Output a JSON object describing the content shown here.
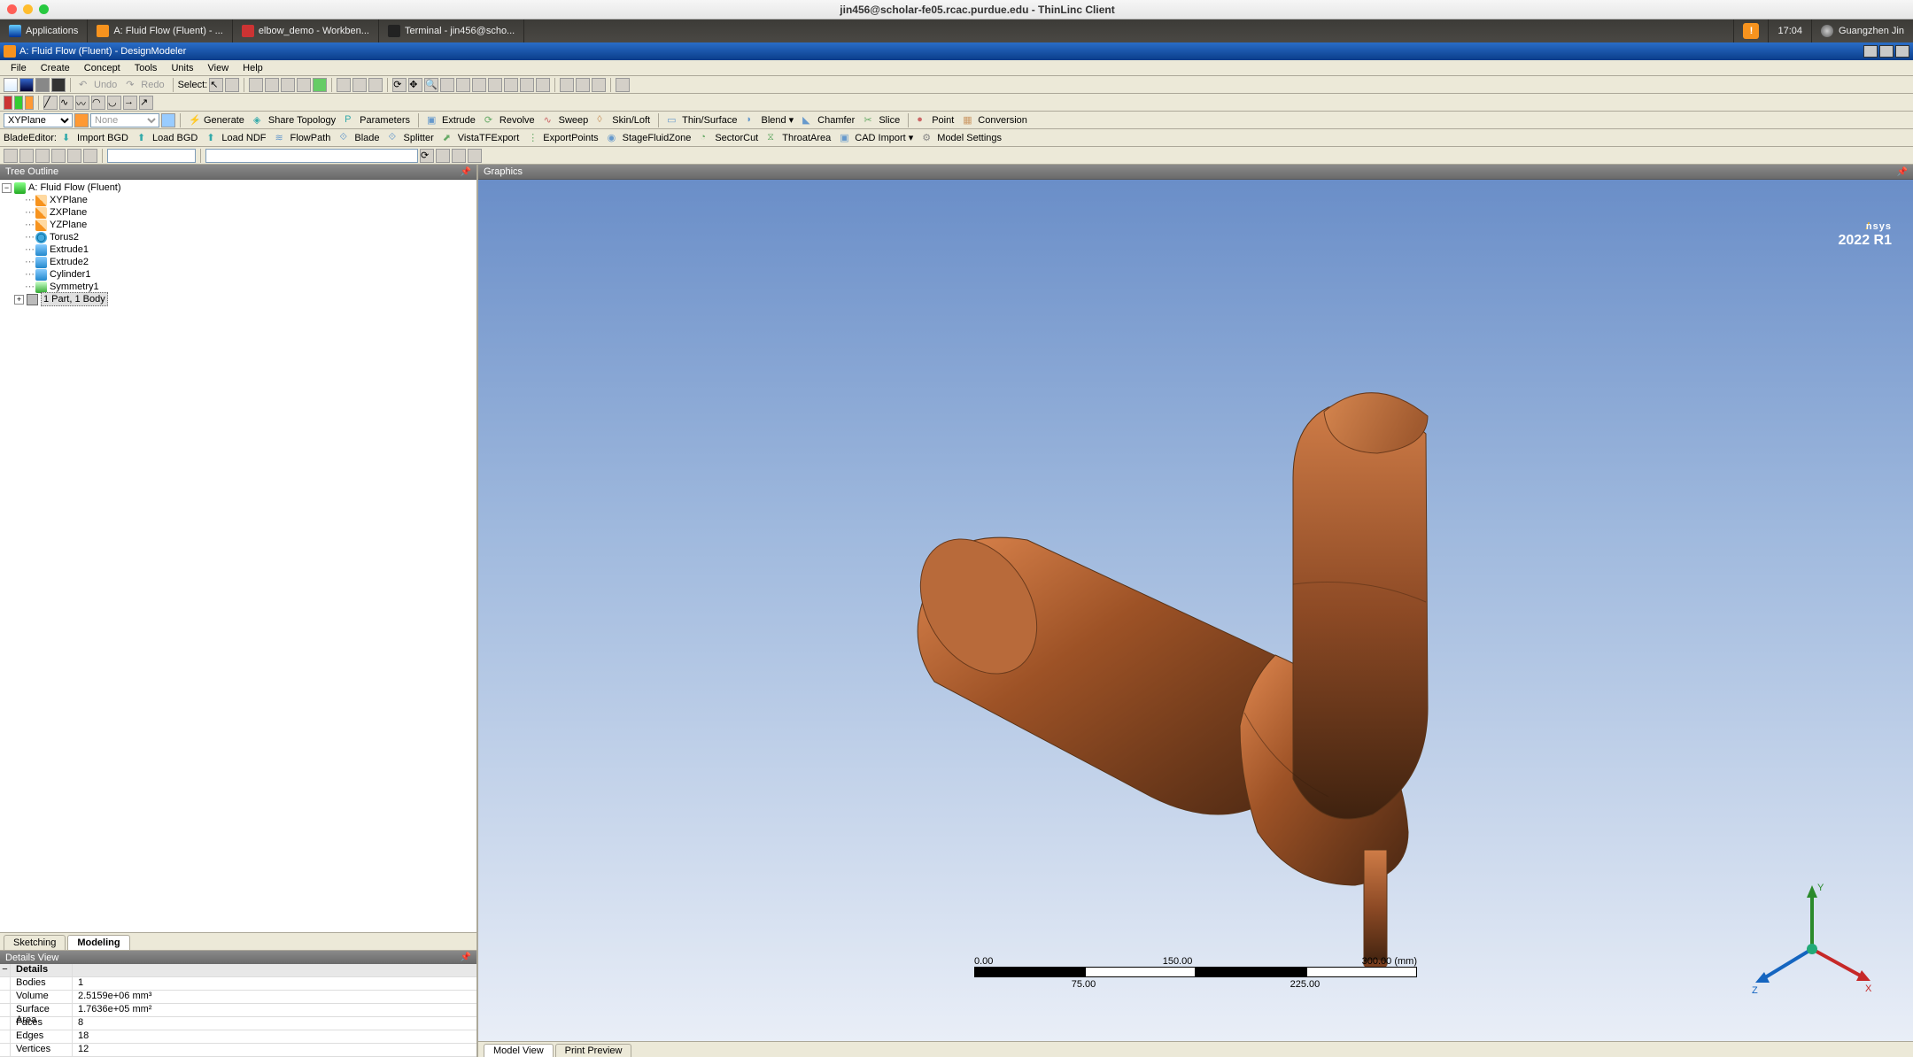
{
  "mac_title": "jin456@scholar-fe05.rcac.purdue.edu - ThinLinc Client",
  "taskbar": {
    "apps": "Applications",
    "items": [
      "A: Fluid Flow (Fluent) - ...",
      "elbow_demo - Workben...",
      "Terminal - jin456@scho..."
    ],
    "clock": "17:04",
    "user": "Guangzhen Jin"
  },
  "window_title": "A: Fluid Flow (Fluent) - DesignModeler",
  "menu": [
    "File",
    "Create",
    "Concept",
    "Tools",
    "Units",
    "View",
    "Help"
  ],
  "tb1": {
    "undo": "Undo",
    "redo": "Redo",
    "select": "Select:"
  },
  "tb3": {
    "plane_sel": "XYPlane",
    "sketch_sel": "None",
    "generate": "Generate",
    "share": "Share Topology",
    "params": "Parameters",
    "extrude": "Extrude",
    "revolve": "Revolve",
    "sweep": "Sweep",
    "skin": "Skin/Loft",
    "thin": "Thin/Surface",
    "blend": "Blend",
    "chamfer": "Chamfer",
    "slice": "Slice",
    "point": "Point",
    "conv": "Conversion"
  },
  "tb4": {
    "label": "BladeEditor:",
    "items": [
      "Import BGD",
      "Load BGD",
      "Load NDF",
      "FlowPath",
      "Blade",
      "Splitter",
      "VistaTFExport",
      "ExportPoints",
      "StageFluidZone",
      "SectorCut",
      "ThroatArea",
      "CAD Import",
      "Model Settings"
    ]
  },
  "tree_title": "Tree Outline",
  "tree": {
    "root": "A: Fluid Flow (Fluent)",
    "items": [
      "XYPlane",
      "ZXPlane",
      "YZPlane",
      "Torus2",
      "Extrude1",
      "Extrude2",
      "Cylinder1",
      "Symmetry1",
      "1 Part, 1 Body"
    ]
  },
  "tabs": {
    "sketching": "Sketching",
    "modeling": "Modeling"
  },
  "details_title": "Details View",
  "details": {
    "header": "Details",
    "rows": [
      {
        "k": "Bodies",
        "v": "1"
      },
      {
        "k": "Volume",
        "v": "2.5159e+06 mm³"
      },
      {
        "k": "Surface Area",
        "v": "1.7636e+05 mm²"
      },
      {
        "k": "Faces",
        "v": "8"
      },
      {
        "k": "Edges",
        "v": "18"
      },
      {
        "k": "Vertices",
        "v": "12"
      }
    ]
  },
  "graphics_title": "Graphics",
  "ansys": {
    "name": "nsys",
    "ver": "2022 R1"
  },
  "scale": {
    "t0": "0.00",
    "t1": "150.00",
    "t2": "300.00 (mm)",
    "b0": "75.00",
    "b1": "225.00"
  },
  "triad": {
    "x": "X",
    "y": "Y",
    "z": "Z"
  },
  "bottom_tabs": {
    "model": "Model View",
    "print": "Print Preview"
  }
}
